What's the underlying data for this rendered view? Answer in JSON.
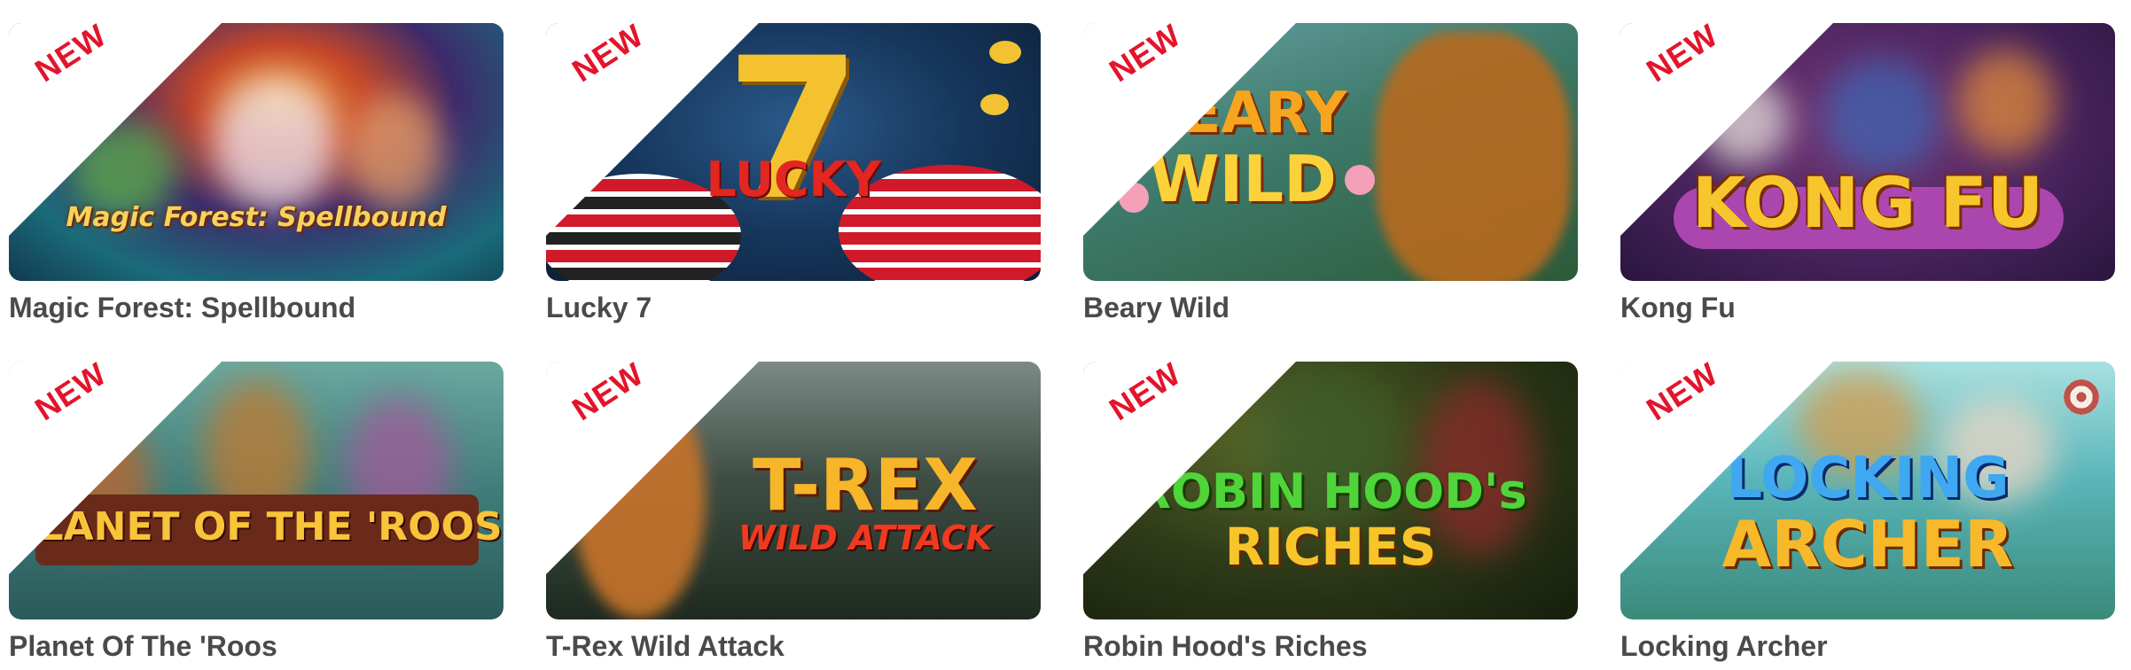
{
  "badge_label": "NEW",
  "games": [
    {
      "title": "Magic Forest: Spellbound",
      "logo_line1": "Magic Forest: Spellbound",
      "logo_line2": "",
      "theme": "magic"
    },
    {
      "title": "Lucky 7",
      "logo_line1": "7",
      "logo_line2": "LUCKY",
      "theme": "lucky"
    },
    {
      "title": "Beary Wild",
      "logo_line1": "BEARY",
      "logo_line2": "WILD",
      "theme": "beary"
    },
    {
      "title": "Kong Fu",
      "logo_line1": "KONG FU",
      "logo_line2": "",
      "theme": "kong"
    },
    {
      "title": "Planet Of The 'Roos",
      "logo_line1": "PLANET OF THE 'ROOS",
      "logo_line2": "",
      "theme": "roos"
    },
    {
      "title": "T-Rex Wild Attack",
      "logo_line1": "T-REX",
      "logo_line2": "WILD ATTACK",
      "theme": "trex"
    },
    {
      "title": "Robin Hood's Riches",
      "logo_line1": "ROBIN HOOD's",
      "logo_line2": "RICHES",
      "theme": "robin"
    },
    {
      "title": "Locking Archer",
      "logo_line1": "LOCKING",
      "logo_line2": "ARCHER",
      "theme": "archer"
    }
  ],
  "colors": {
    "badge_text": "#e3142b",
    "title_text": "#4a4a4a"
  }
}
